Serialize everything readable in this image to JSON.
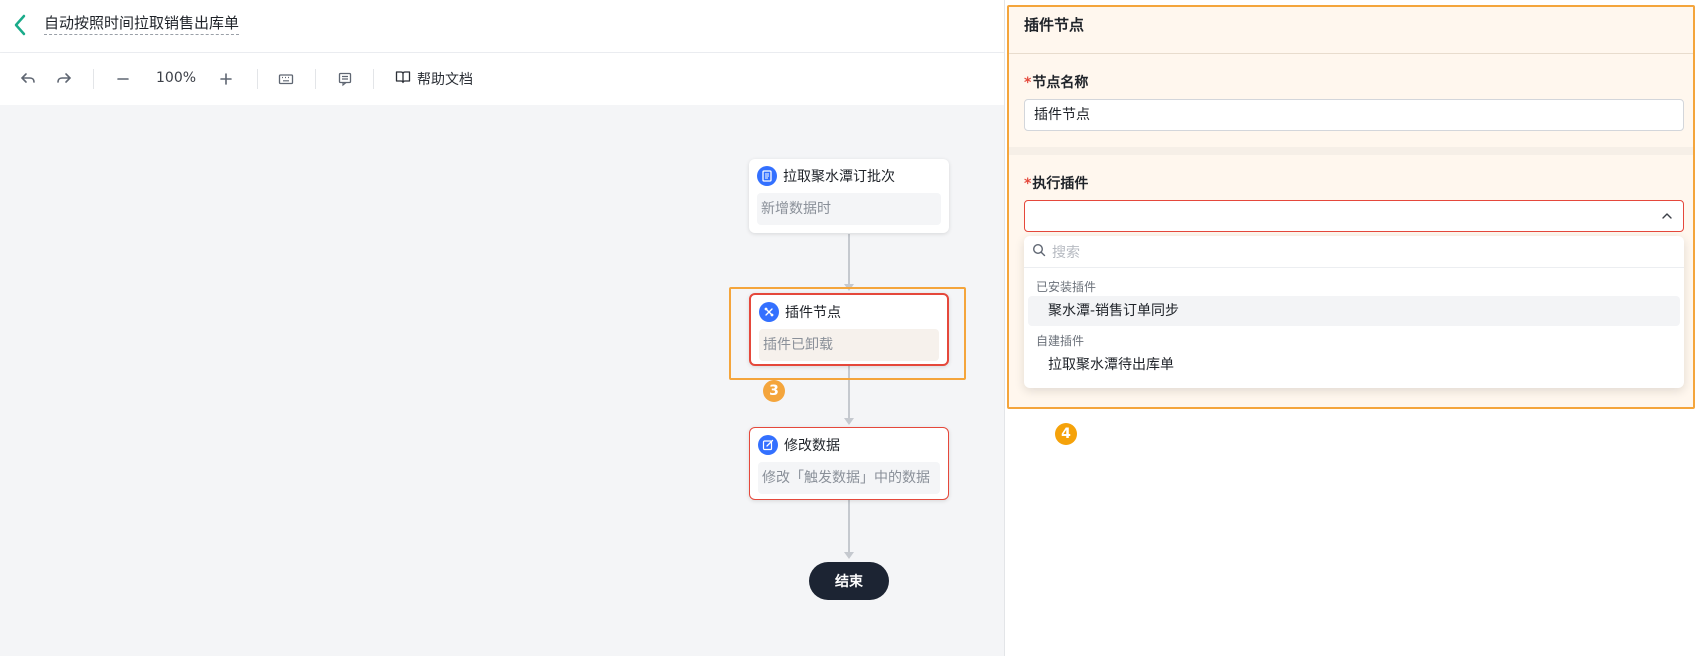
{
  "header": {
    "title": "自动按照时间拉取销售出库单"
  },
  "toolbar": {
    "zoom": "100%",
    "help_label": "帮助文档"
  },
  "nodes": [
    {
      "title": "拉取聚水潭订批次",
      "body": "新增数据时"
    },
    {
      "title": "插件节点",
      "body": "插件已卸载"
    },
    {
      "title": "修改数据",
      "body": "修改「触发数据」中的数据"
    }
  ],
  "end_label": "结束",
  "annotations": {
    "left_badge": "3",
    "right_badge": "4"
  },
  "panel": {
    "title": "插件节点",
    "name_label": "节点名称",
    "required_mark": "*",
    "name_value": "插件节点",
    "plugin_label": "执行插件",
    "search_placeholder": "搜索",
    "groups": [
      {
        "label": "已安装插件",
        "items": [
          "聚水潭-销售订单同步"
        ]
      },
      {
        "label": "自建插件",
        "items": [
          "拉取聚水潭待出库单"
        ]
      }
    ]
  },
  "colors": {
    "accent": "#3370ff",
    "highlight": "#f4a53c",
    "error": "#e5483b",
    "back": "#1aab8a"
  }
}
